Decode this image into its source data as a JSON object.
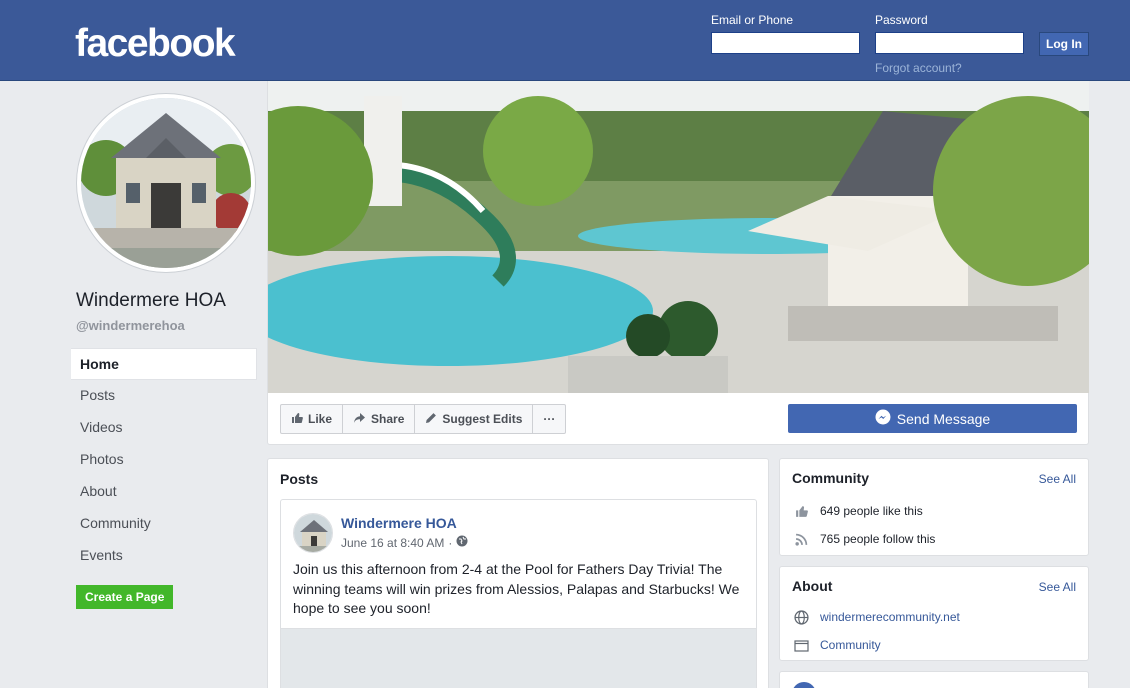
{
  "header": {
    "logo": "facebook",
    "email_label": "Email or Phone",
    "password_label": "Password",
    "email_value": "",
    "password_value": "",
    "login_button": "Log In",
    "forgot_link": "Forgot account?"
  },
  "page": {
    "name": "Windermere HOA",
    "handle": "@windermerehoa"
  },
  "nav": {
    "items": [
      {
        "label": "Home",
        "active": true
      },
      {
        "label": "Posts"
      },
      {
        "label": "Videos"
      },
      {
        "label": "Photos"
      },
      {
        "label": "About"
      },
      {
        "label": "Community"
      },
      {
        "label": "Events"
      }
    ],
    "create_page": "Create a Page"
  },
  "actions": {
    "like": "Like",
    "share": "Share",
    "suggest_edits": "Suggest Edits",
    "more": "···",
    "send_message": "Send Message"
  },
  "posts": {
    "title": "Posts",
    "items": [
      {
        "author": "Windermere HOA",
        "date": "June 16 at 8:40 AM",
        "separator": "·",
        "privacy_icon": "globe-icon",
        "text": "Join us this afternoon from 2-4 at the Pool for Fathers Day Trivia! The winning teams will win prizes from Alessios, Palapas and Starbucks! We hope to see you soon!"
      }
    ]
  },
  "community": {
    "title": "Community",
    "see_all": "See All",
    "likes": "649 people like this",
    "follows": "765 people follow this"
  },
  "about": {
    "title": "About",
    "see_all": "See All",
    "website": "windermerecommunity.net",
    "category": "Community"
  },
  "colors": {
    "header_bg": "#3b5998",
    "primary_button": "#4267b2",
    "create_button": "#42b72a",
    "link": "#365899",
    "page_bg": "#e9ebee"
  }
}
